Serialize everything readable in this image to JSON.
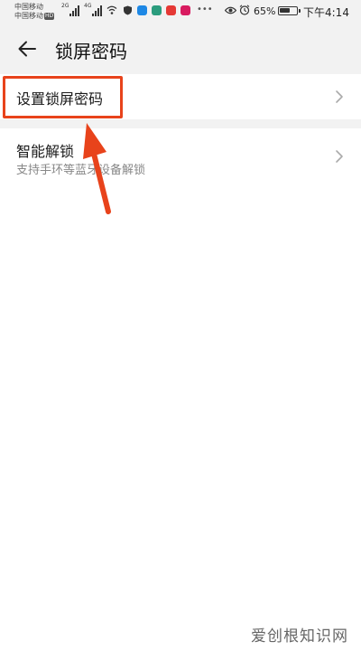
{
  "status_bar": {
    "carrier_1": "中国移动",
    "carrier_2": "中国移动",
    "hd_badge": "HD",
    "network_1": "2G",
    "network_2": "4G",
    "battery_level": 65,
    "battery_text": "65%",
    "time": "下午4:14",
    "app_icon_colors": [
      "#1e88e5",
      "#2b9c7d",
      "#e53935",
      "#d81b60"
    ]
  },
  "header": {
    "back_icon": "arrow-left-icon",
    "title": "锁屏密码"
  },
  "settings": {
    "items": [
      {
        "title": "设置锁屏密码",
        "subtitle": "",
        "icon": "chevron-right-icon"
      },
      {
        "title": "智能解锁",
        "subtitle": "支持手环等蓝牙设备解锁",
        "icon": "chevron-right-icon"
      }
    ]
  },
  "annotation": {
    "color": "#e8431b",
    "arrow_icon": "red-arrow-icon"
  },
  "watermark": "爱创根知识网"
}
